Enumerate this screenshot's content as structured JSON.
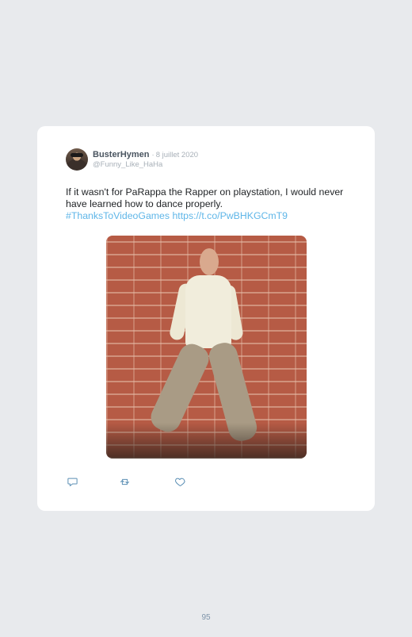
{
  "tweet": {
    "author_name": "BusterHymen",
    "separator": "·",
    "date": "8 juillet 2020",
    "handle": "@Funny_Like_HaHa",
    "text_plain": "If it wasn't for PaRappa the Rapper on playstation, I would never have learned how to dance properly.",
    "hashtag": "#ThanksToVideoGames",
    "link": "https://t.co/PwBHKGCmT9"
  },
  "icons": {
    "reply": "reply-icon",
    "retweet": "retweet-icon",
    "like": "heart-icon"
  },
  "page": {
    "number": "95"
  }
}
